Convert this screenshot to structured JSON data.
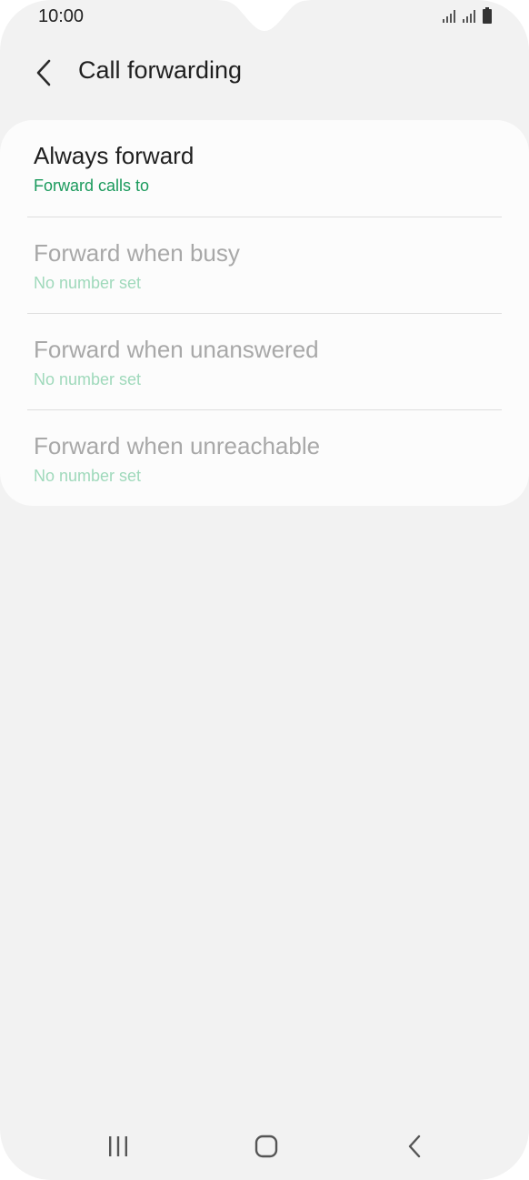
{
  "status_bar": {
    "time": "10:00",
    "icons": [
      "signal-icon",
      "signal-icon",
      "battery-icon"
    ]
  },
  "header": {
    "back_icon": "chevron-left-icon",
    "title": "Call forwarding"
  },
  "items": [
    {
      "title": "Always forward",
      "subtitle": "Forward calls to",
      "enabled": true
    },
    {
      "title": "Forward when busy",
      "subtitle": "No number set",
      "enabled": false
    },
    {
      "title": "Forward when unanswered",
      "subtitle": "No number set",
      "enabled": false
    },
    {
      "title": "Forward when unreachable",
      "subtitle": "No number set",
      "enabled": false
    }
  ],
  "nav_bar": {
    "icons": [
      "recent-apps-icon",
      "home-icon",
      "back-icon"
    ]
  },
  "colors": {
    "background": "#f2f2f2",
    "card": "#fcfcfc",
    "accent_green": "#1a9a5c",
    "accent_green_disabled": "#9fd9bb",
    "text_primary": "#1f1f1f",
    "text_disabled": "#a8a8a8"
  }
}
